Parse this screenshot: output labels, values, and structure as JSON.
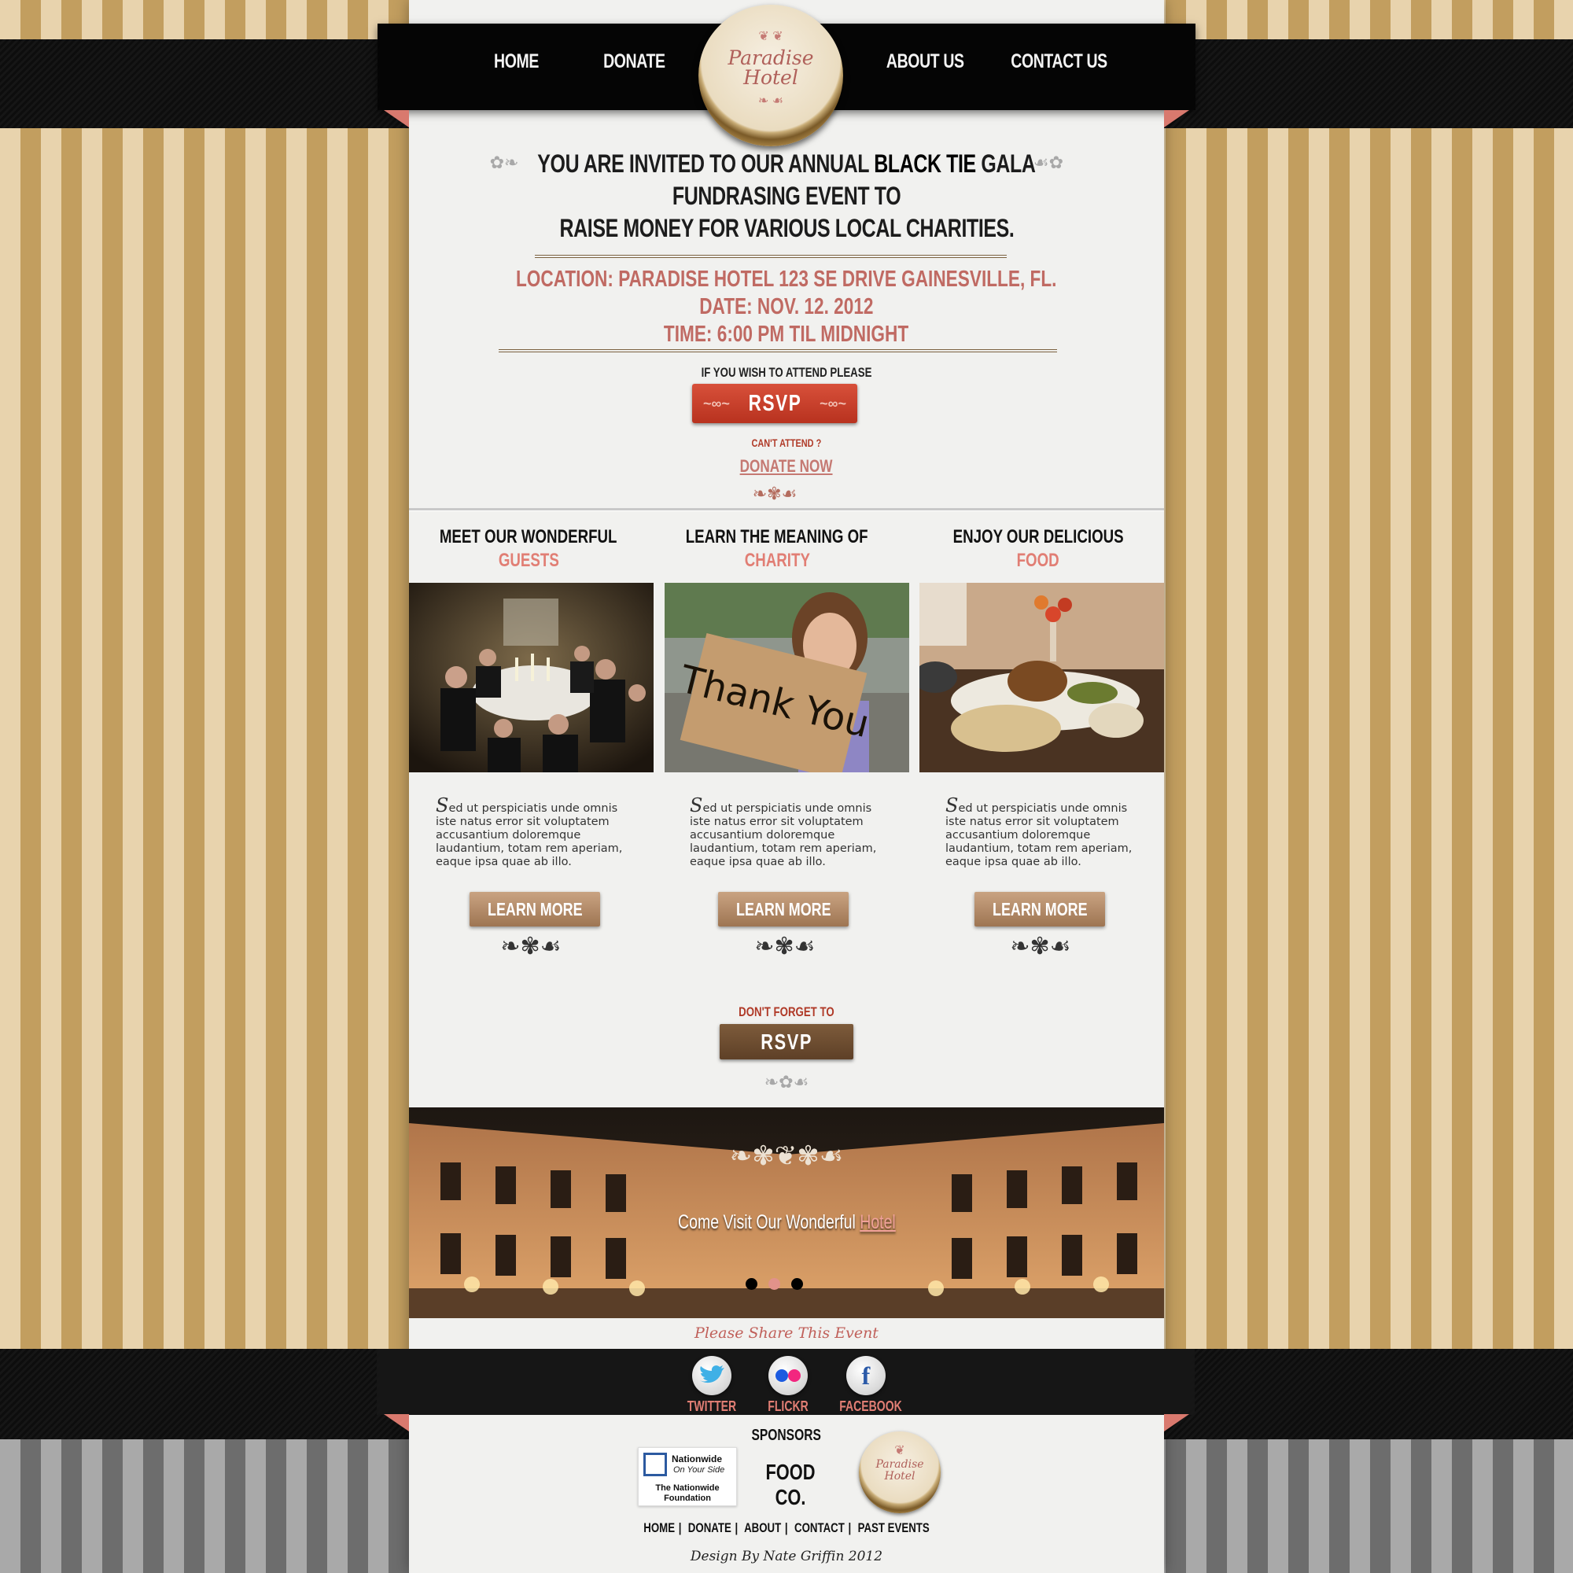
{
  "nav": {
    "home": "HOME",
    "donate": "DONATE",
    "about": "ABOUT US",
    "contact": "CONTACT US"
  },
  "logo": {
    "line1": "Paradise",
    "line2": "Hotel"
  },
  "invite": {
    "line1_a": "YOU ARE INVITED TO OUR ANNUAL ",
    "line1_b": "BLACK TIE",
    "line1_c": " GALA",
    "line2": "FUNDRASING EVENT TO",
    "line3": "RAISE MONEY FOR VARIOUS LOCAL CHARITIES."
  },
  "event": {
    "location": "LOCATION: PARADISE HOTEL 123 SE DRIVE GAINESVILLE, FL.",
    "date": "DATE: NOV. 12. 2012",
    "time": "TIME: 6:00 PM TIL MIDNIGHT"
  },
  "rsvp": {
    "prompt": "IF YOU WISH TO ATTEND PLEASE",
    "button": "RSVP",
    "cant_attend": "CAN'T ATTEND ?",
    "donate_now": "DONATE NOW"
  },
  "columns": [
    {
      "title_1": "MEET OUR WONDERFUL",
      "title_2": "GUESTS",
      "image": "gala-guests-photo",
      "text_cap": "S",
      "text": "ed ut perspiciatis unde omnis iste natus error sit voluptatem accusantium doloremque laudantium, totam rem aperiam, eaque ipsa quae ab illo.",
      "button": "LEARN MORE"
    },
    {
      "title_1": "LEARN THE MEANING OF",
      "title_2": "CHARITY",
      "image": "thank-you-sign-photo",
      "sign_text": "Thank You",
      "text_cap": "S",
      "text": "ed ut perspiciatis unde omnis iste natus error sit voluptatem accusantium doloremque laudantium, totam rem aperiam, eaque ipsa quae ab illo.",
      "button": "LEARN MORE"
    },
    {
      "title_1": "ENJOY OUR DELICIOUS",
      "title_2": "FOOD",
      "image": "buffet-food-photo",
      "text_cap": "S",
      "text": "ed ut perspiciatis unde omnis iste natus error sit voluptatem accusantium doloremque laudantium, totam rem aperiam, eaque ipsa quae ab illo.",
      "button": "LEARN MORE"
    }
  ],
  "reminder": {
    "label": "DON'T FORGET TO",
    "button": "RSVP"
  },
  "banner": {
    "text_a": "Come Visit Our Wonderful ",
    "text_b": "Hotel",
    "slides": 3,
    "active_slide": 2
  },
  "share": {
    "label": "Please Share This Event",
    "items": [
      {
        "label": "TWITTER",
        "icon": "twitter-icon"
      },
      {
        "label": "FLICKR",
        "icon": "flickr-icon"
      },
      {
        "label": "FACEBOOK",
        "icon": "facebook-icon"
      }
    ]
  },
  "sponsors": {
    "title": "SPONSORS",
    "nationwide_name": "Nationwide",
    "nationwide_tag": "On Your Side",
    "nationwide_foundation": "The Nationwide Foundation",
    "foodco": "FOOD CO."
  },
  "footer": {
    "links": [
      "HOME",
      "DONATE",
      "ABOUT",
      "CONTACT",
      "PAST EVENTS"
    ],
    "credit": "Design By Nate Griffin 2012"
  },
  "colors": {
    "accent_pink": "#e17e74",
    "rsvp_red": "#c8412c",
    "learn_brown": "#b58c69",
    "stripe_light": "#e8d3ad",
    "stripe_dark": "#c29e5f"
  }
}
